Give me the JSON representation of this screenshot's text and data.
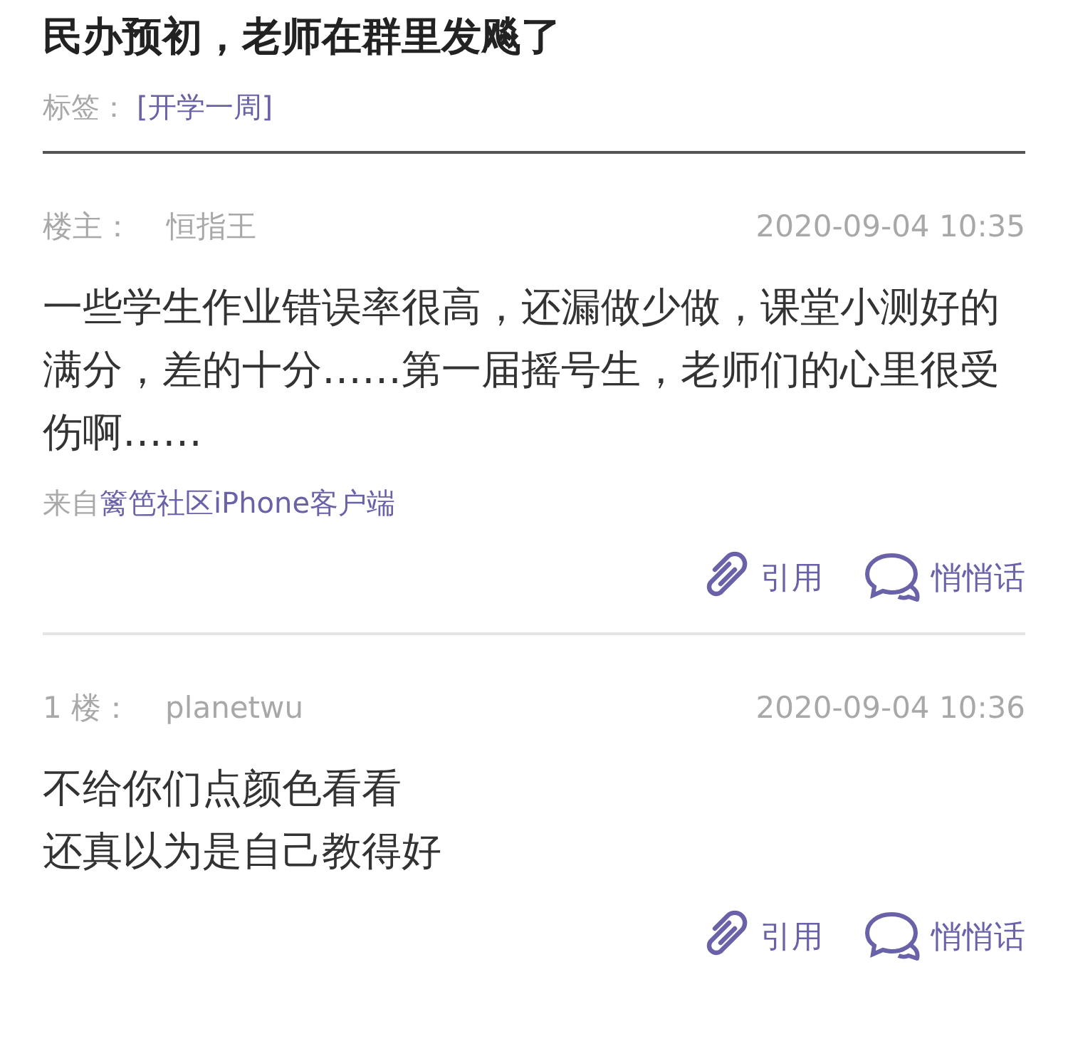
{
  "title": "民办预初，老师在群里发飚了",
  "tags": {
    "label": "标签：",
    "value": "[开学一周]"
  },
  "posts": [
    {
      "floor": "楼主：",
      "author": "恒指王",
      "time": "2020-09-04 10:35",
      "lines": [
        "一些学生作业错误率很高，还漏做少做，课堂小测好的满分，差的十分……第一届摇号生，老师们的心里很受伤啊……"
      ],
      "source": {
        "prefix": "来自",
        "link": "篱笆社区iPhone客户端"
      },
      "actions": [
        {
          "kind": "quote",
          "label": "引用"
        },
        {
          "kind": "whisper",
          "label": "悄悄话"
        }
      ]
    },
    {
      "floor": "1 楼：",
      "author": "planetwu",
      "time": "2020-09-04 10:36",
      "lines": [
        "不给你们点颜色看看",
        "还真以为是自己教得好"
      ],
      "actions": [
        {
          "kind": "quote",
          "label": "引用"
        },
        {
          "kind": "whisper",
          "label": "悄悄话"
        }
      ]
    }
  ]
}
